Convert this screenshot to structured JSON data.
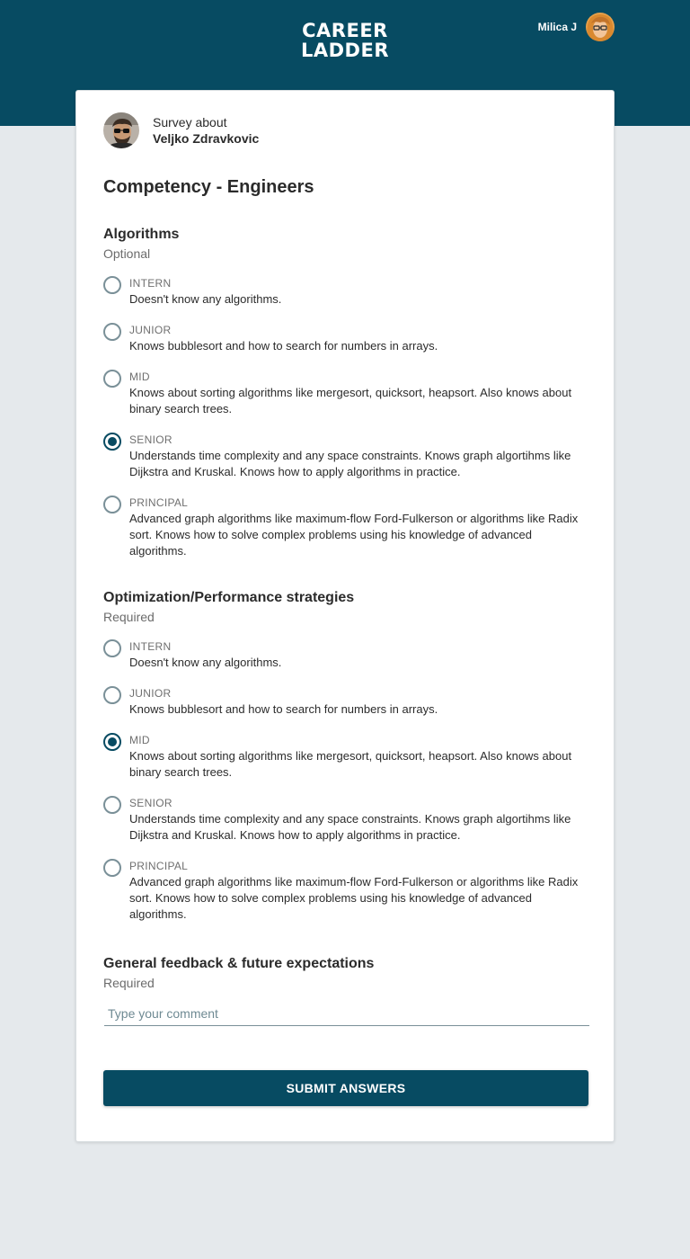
{
  "header": {
    "logo_line1": "CAREER",
    "logo_line2": "LADDER",
    "user_name": "Milica J",
    "brand_color": "#074b62"
  },
  "subject": {
    "prefix": "Survey about",
    "name": "Veljko Zdravkovic"
  },
  "survey": {
    "title": "Competency - Engineers"
  },
  "questions": [
    {
      "title": "Algorithms",
      "requirement": "Optional",
      "selected": "SENIOR",
      "options": [
        {
          "level": "INTERN",
          "description": "Doesn't know any algorithms."
        },
        {
          "level": "JUNIOR",
          "description": "Knows bubblesort and how to search for numbers in arrays."
        },
        {
          "level": "MID",
          "description": "Knows about sorting algorithms like mergesort, quicksort, heapsort. Also knows about binary search trees."
        },
        {
          "level": "SENIOR",
          "description": "Understands time complexity and any space constraints. Knows graph algortihms like Dijkstra and Kruskal. Knows how to apply algorithms in practice."
        },
        {
          "level": "PRINCIPAL",
          "description": "Advanced graph algorithms like maximum-flow Ford-Fulkerson or algorithms like Radix sort. Knows how to solve complex problems using his knowledge of advanced algorithms."
        }
      ]
    },
    {
      "title": "Optimization/Performance strategies",
      "requirement": "Required",
      "selected": "MID",
      "options": [
        {
          "level": "INTERN",
          "description": "Doesn't know any algorithms."
        },
        {
          "level": "JUNIOR",
          "description": "Knows bubblesort and how to search for numbers in arrays."
        },
        {
          "level": "MID",
          "description": "Knows about sorting algorithms like mergesort, quicksort, heapsort. Also knows about binary search trees."
        },
        {
          "level": "SENIOR",
          "description": "Understands time complexity and any space constraints. Knows graph algortihms like Dijkstra and Kruskal. Knows how to apply algorithms in practice."
        },
        {
          "level": "PRINCIPAL",
          "description": "Advanced graph algorithms like maximum-flow Ford-Fulkerson or algorithms like Radix sort. Knows how to solve complex problems using his knowledge of advanced algorithms."
        }
      ]
    },
    {
      "title": "General feedback & future expectations",
      "requirement": "Required",
      "placeholder": "Type your comment",
      "value": ""
    }
  ],
  "submit_label": "SUBMIT ANSWERS"
}
